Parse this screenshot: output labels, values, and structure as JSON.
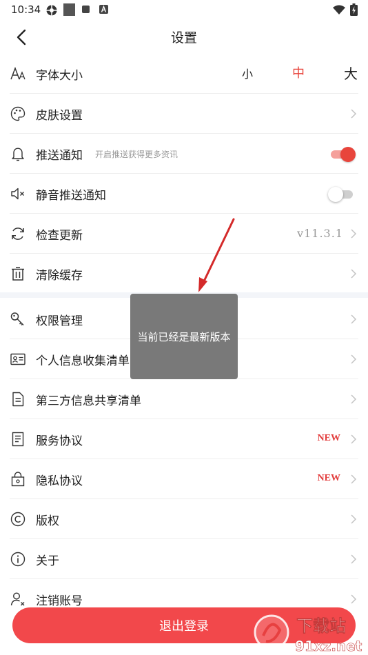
{
  "status_bar": {
    "time": "10:34",
    "icons": [
      "settings-gear-notification-icon",
      "square-notification-icon",
      "small-square-notification-icon",
      "a-letter-notification-icon",
      "wifi-icon",
      "battery-charging-icon"
    ]
  },
  "header": {
    "title": "设置",
    "back_icon": "chevron-left-icon"
  },
  "font_size": {
    "label": "字体大小",
    "options": [
      "小",
      "中",
      "大"
    ],
    "selected": "中"
  },
  "rows": {
    "skin": {
      "label": "皮肤设置"
    },
    "push": {
      "label": "推送通知",
      "hint": "开启推送获得更多资讯",
      "enabled": true
    },
    "silent": {
      "label": "静音推送通知",
      "enabled": false
    },
    "update": {
      "label": "检查更新",
      "value": "v11.3.1"
    },
    "cache": {
      "label": "清除缓存"
    },
    "permissions": {
      "label": "权限管理"
    },
    "personal_info": {
      "label": "个人信息收集清单"
    },
    "third_party": {
      "label": "第三方信息共享清单"
    },
    "service": {
      "label": "服务协议",
      "badge": "NEW"
    },
    "privacy": {
      "label": "隐私协议",
      "badge": "NEW"
    },
    "copyright": {
      "label": "版权"
    },
    "about": {
      "label": "关于"
    },
    "deregister": {
      "label": "注销账号"
    }
  },
  "toast": {
    "message": "当前已经是最新版本"
  },
  "logout_button": {
    "label": "退出登录"
  },
  "watermark": {
    "brand": "下载站",
    "domain": "91xz.net"
  },
  "colors": {
    "accent": "#f2484b",
    "badge": "#e23b3b",
    "toggle_on_knob": "#e8453c",
    "toggle_on_track": "#f5a09b",
    "toggle_off_knob": "#ffffff",
    "toggle_off_track": "#cfcfcf"
  }
}
